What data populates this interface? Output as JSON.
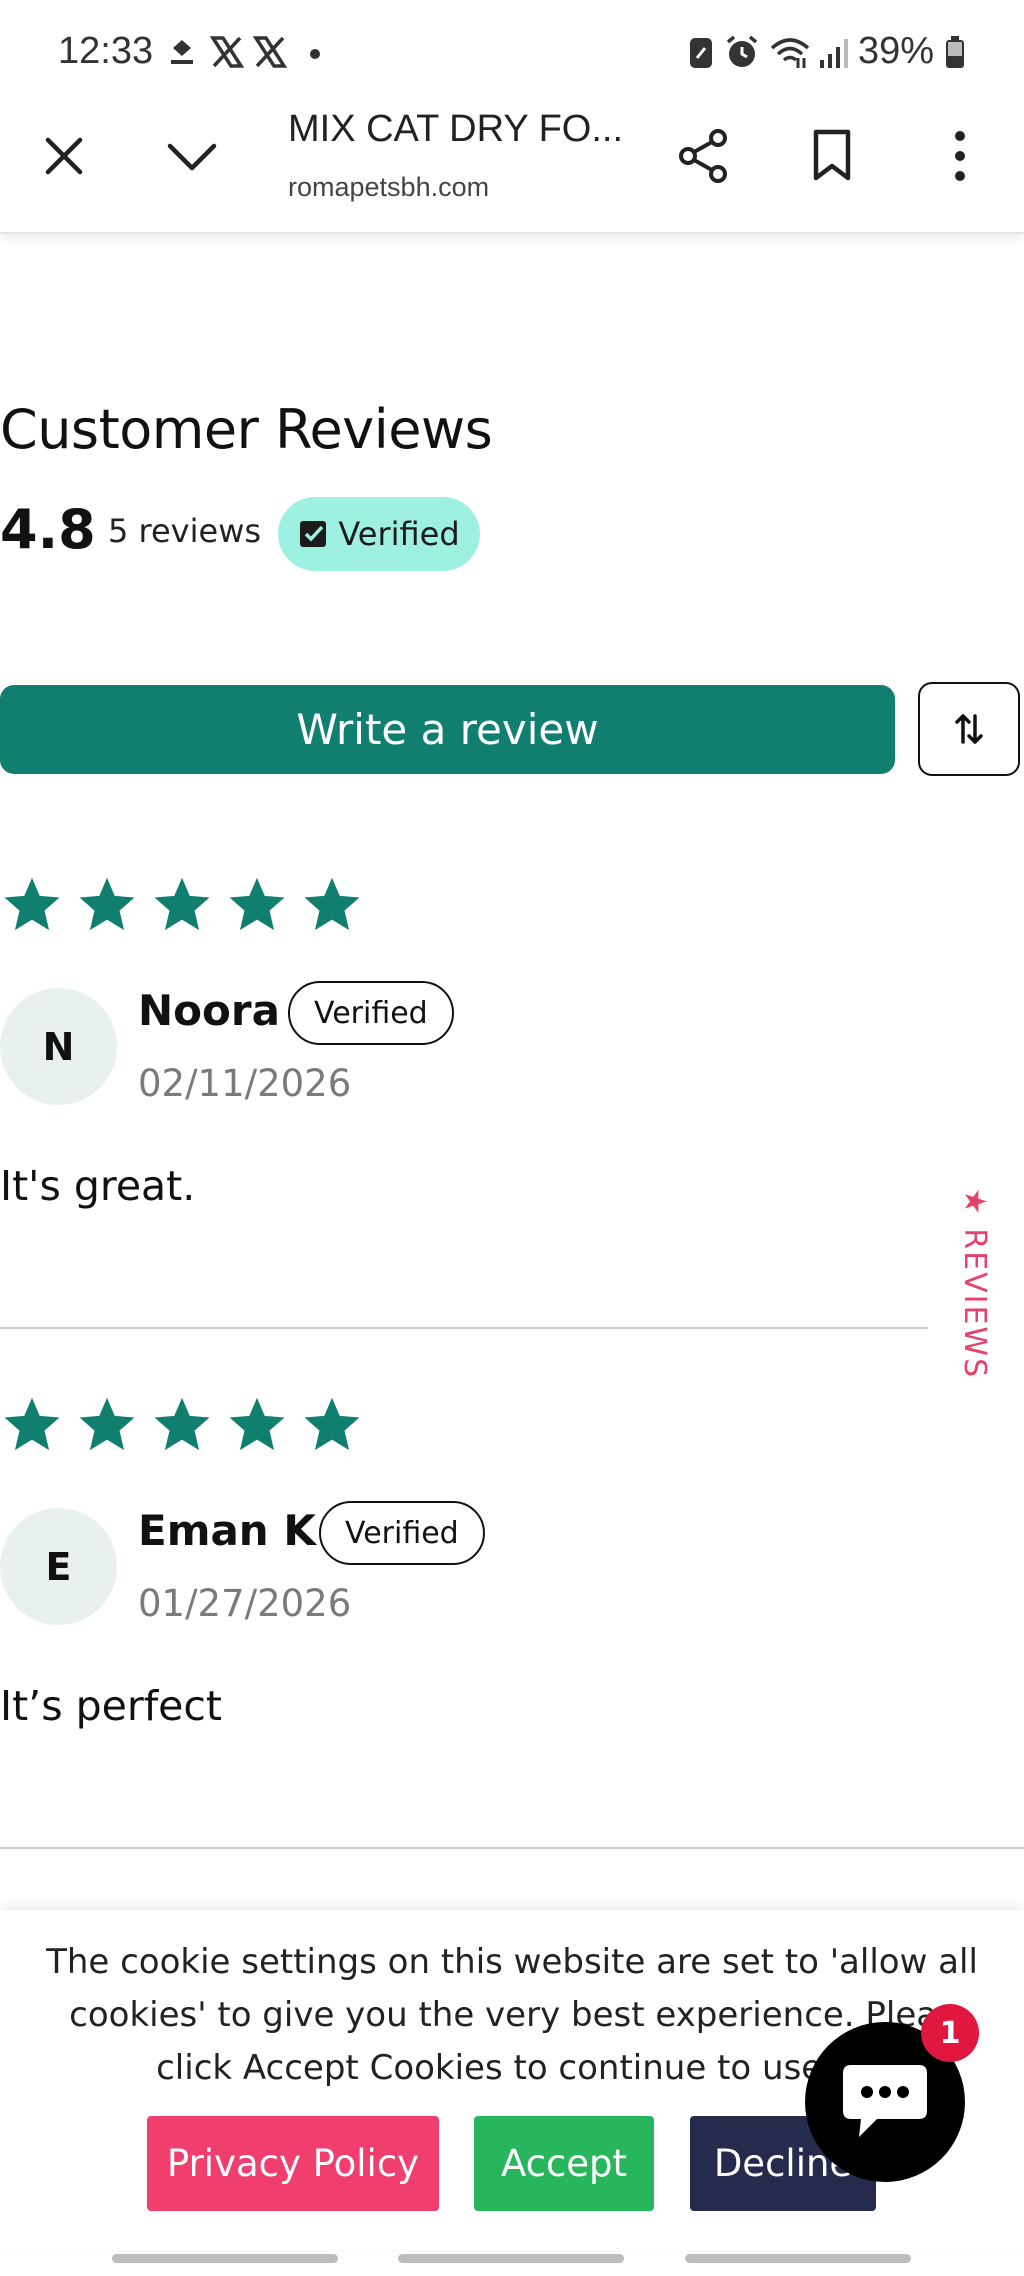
{
  "status_bar": {
    "time": "12:33",
    "battery": "39%",
    "icons": [
      "efc-pay-icon",
      "x-icon",
      "x-icon",
      "dot-icon",
      "battery-saver-icon",
      "alarm-icon",
      "wifi-icon",
      "signal-icon",
      "battery-icon"
    ]
  },
  "toolbar": {
    "title": "MIX CAT DRY FO...",
    "domain": "romapetsbh.com",
    "icons": [
      "close-icon",
      "chevron-down-icon",
      "share-icon",
      "bookmark-icon",
      "more-vert-icon"
    ]
  },
  "reviews": {
    "heading": "Customer Reviews",
    "average_rating": "4.8",
    "count_label": "5 reviews",
    "verified_label": "Verified",
    "write_review_label": "Write a review",
    "side_tab_label": "★ REVIEWS",
    "star_color": "#117f70",
    "items": [
      {
        "initial": "N",
        "name": "Noora",
        "badge": "Verified",
        "date": "02/11/2026",
        "body": "It's great.",
        "rating": 5
      },
      {
        "initial": "E",
        "name": "Eman K",
        "badge": "Verified",
        "date": "01/27/2026",
        "body": "It’s perfect",
        "rating": 5
      }
    ]
  },
  "cookie_banner": {
    "text_lines": [
      "The cookie settings on this website are set to 'allow all",
      "cookies' to give you the very best experience. Pleas",
      "click Accept Cookies to continue to use th"
    ],
    "privacy_label": "Privacy Policy",
    "accept_label": "Accept",
    "decline_label": "Decline"
  },
  "chat": {
    "badge_count": "1"
  },
  "colors": {
    "brand_green": "#117f70",
    "verified_bg": "#9ef0e1",
    "privacy_pink": "#f03e6e",
    "accept_green": "#27b65b",
    "decline_navy": "#262b4e"
  }
}
